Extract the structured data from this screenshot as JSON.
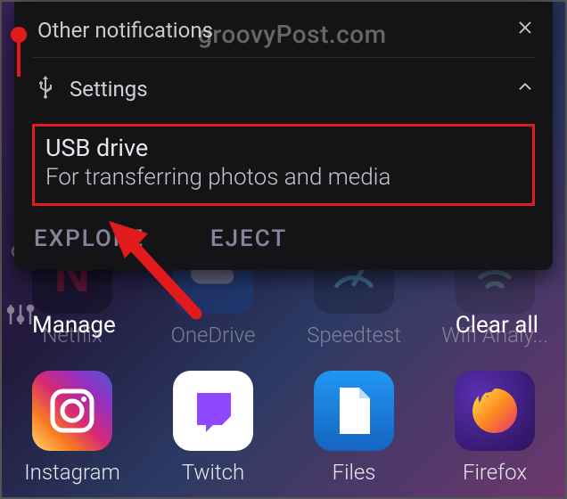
{
  "watermark": "groovyPost.com",
  "panel": {
    "header_title": "Other notifications"
  },
  "notification": {
    "app": "Settings",
    "title": "USB drive",
    "subtitle": "For transferring photos and media",
    "actions": {
      "explore": "EXPLORE",
      "eject": "EJECT"
    }
  },
  "footer": {
    "manage": "Manage",
    "clear_all": "Clear all"
  },
  "apps_row_back": [
    {
      "label": "Netflix"
    },
    {
      "label": "OneDrive"
    },
    {
      "label": "Speedtest"
    },
    {
      "label": "Wifi Analy..."
    }
  ],
  "apps_row_front": [
    {
      "label": "Instagram"
    },
    {
      "label": "Twitch"
    },
    {
      "label": "Files"
    },
    {
      "label": "Firefox"
    }
  ],
  "annotation": {
    "highlight_color": "#e11b1b"
  }
}
